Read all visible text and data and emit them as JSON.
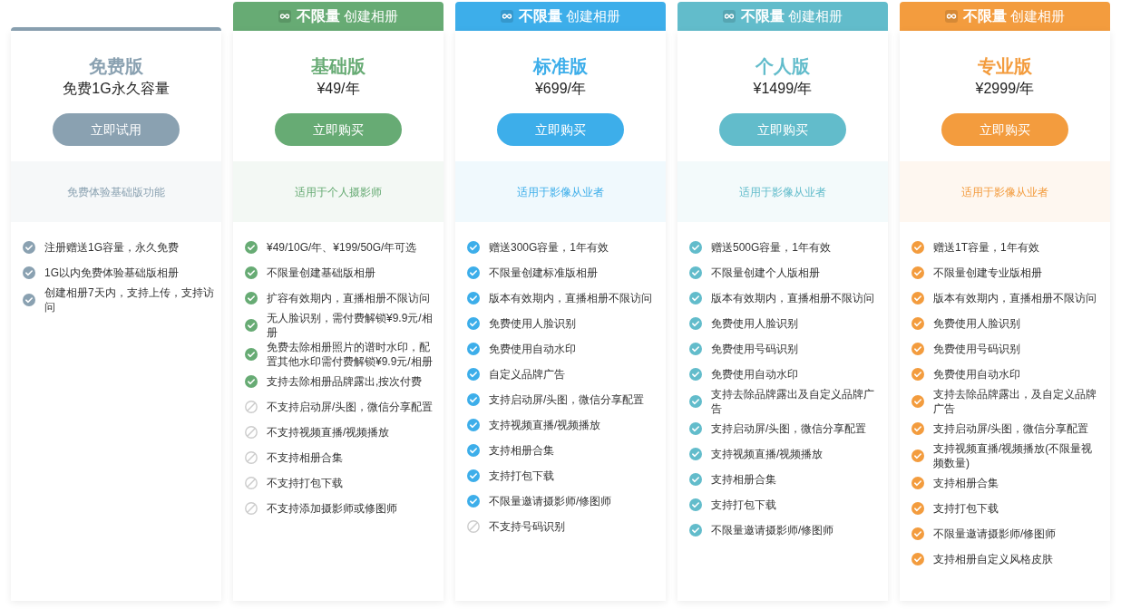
{
  "plans": [
    {
      "name": "免费版",
      "price": "免费1G永久容量",
      "button": "立即试用",
      "audience": "免费体验基础版功能",
      "color": "#8aa1b1",
      "features": [
        {
          "text": "注册赠送1G容量，永久免费",
          "included": true
        },
        {
          "text": "1G以内免费体验基础版相册",
          "included": true
        },
        {
          "text": "创建相册7天内，支持上传，支持访问",
          "included": true
        }
      ]
    },
    {
      "banner": "**不限量** 创建相册",
      "name": "基础版",
      "price": "¥49/年",
      "button": "立即购买",
      "audience": "适用于个人摄影师",
      "color": "#67ab74",
      "features": [
        {
          "text": "¥49/10G/年、¥199/50G/年可选",
          "included": true
        },
        {
          "text": "不限量创建基础版相册",
          "included": true
        },
        {
          "text": "扩容有效期内，直播相册不限访问",
          "included": true
        },
        {
          "text": "无人脸识别，需付费解锁¥9.9元/相册",
          "included": true
        },
        {
          "text": "免费去除相册照片的谱时水印，配置其他水印需付费解锁¥9.9元/相册",
          "included": true
        },
        {
          "text": "支持去除相册品牌露出,按次付费",
          "included": true
        },
        {
          "text": "不支持启动屏/头图，微信分享配置",
          "included": false
        },
        {
          "text": "不支持视频直播/视频播放",
          "included": false
        },
        {
          "text": "不支持相册合集",
          "included": false
        },
        {
          "text": "不支持打包下载",
          "included": false
        },
        {
          "text": "不支持添加摄影师或修图师",
          "included": false
        }
      ]
    },
    {
      "banner": "**不限量** 创建相册",
      "name": "标准版",
      "price": "¥699/年",
      "button": "立即购买",
      "audience": "适用于影像从业者",
      "color": "#3daeea",
      "features": [
        {
          "text": "赠送300G容量，1年有效",
          "included": true
        },
        {
          "text": "不限量创建标准版相册",
          "included": true
        },
        {
          "text": "版本有效期内，直播相册不限访问",
          "included": true
        },
        {
          "text": "免费使用人脸识别",
          "included": true
        },
        {
          "text": "免费使用自动水印",
          "included": true
        },
        {
          "text": "自定义品牌广告",
          "included": true
        },
        {
          "text": "支持启动屏/头图，微信分享配置",
          "included": true
        },
        {
          "text": "支持视频直播/视频播放",
          "included": true
        },
        {
          "text": "支持相册合集",
          "included": true
        },
        {
          "text": "支持打包下载",
          "included": true
        },
        {
          "text": "不限量邀请摄影师/修图师",
          "included": true
        },
        {
          "text": "不支持号码识别",
          "included": false
        }
      ]
    },
    {
      "banner": "**不限量** 创建相册",
      "name": "个人版",
      "price": "¥1499/年",
      "button": "立即购买",
      "audience": "适用于影像从业者",
      "color": "#62bccb",
      "features": [
        {
          "text": "赠送500G容量，1年有效",
          "included": true
        },
        {
          "text": "不限量创建个人版相册",
          "included": true
        },
        {
          "text": "版本有效期内，直播相册不限访问",
          "included": true
        },
        {
          "text": "免费使用人脸识别",
          "included": true
        },
        {
          "text": "免费使用号码识别",
          "included": true
        },
        {
          "text": "免费使用自动水印",
          "included": true
        },
        {
          "text": "支持去除品牌露出及自定义品牌广告",
          "included": true
        },
        {
          "text": "支持启动屏/头图，微信分享配置",
          "included": true
        },
        {
          "text": "支持视频直播/视频播放",
          "included": true
        },
        {
          "text": "支持相册合集",
          "included": true
        },
        {
          "text": "支持打包下载",
          "included": true
        },
        {
          "text": "不限量邀请摄影师/修图师",
          "included": true
        }
      ]
    },
    {
      "banner": "**不限量** 创建相册",
      "name": "专业版",
      "price": "¥2999/年",
      "button": "立即购买",
      "audience": "适用于影像从业者",
      "color": "#f39c3e",
      "features": [
        {
          "text": "赠送1T容量，1年有效",
          "included": true
        },
        {
          "text": "不限量创建专业版相册",
          "included": true
        },
        {
          "text": "版本有效期内，直播相册不限访问",
          "included": true
        },
        {
          "text": "免费使用人脸识别",
          "included": true
        },
        {
          "text": "免费使用号码识别",
          "included": true
        },
        {
          "text": "免费使用自动水印",
          "included": true
        },
        {
          "text": "支持去除品牌露出，及自定义品牌广告",
          "included": true
        },
        {
          "text": "支持启动屏/头图，微信分享配置",
          "included": true
        },
        {
          "text": "支持视频直播/视频播放(不限量视频数量)",
          "included": true
        },
        {
          "text": "支持相册合集",
          "included": true
        },
        {
          "text": "支持打包下载",
          "included": true
        },
        {
          "text": "不限量邀请摄影师/修图师",
          "included": true
        },
        {
          "text": "支持相册自定义风格皮肤",
          "included": true
        }
      ]
    }
  ]
}
